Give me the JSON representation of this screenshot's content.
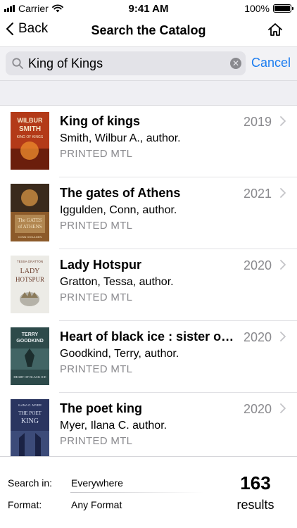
{
  "status_bar": {
    "carrier": "Carrier",
    "time": "9:41 AM",
    "battery_text": "100%",
    "battery_level": 1.0
  },
  "nav": {
    "back_label": "Back",
    "title": "Search the Catalog",
    "home_icon": "home-icon"
  },
  "search": {
    "value": "King of Kings",
    "cancel_label": "Cancel"
  },
  "results": [
    {
      "title": "King of kings",
      "year": "2019",
      "author": "Smith, Wilbur A., author.",
      "format": "PRINTED MTL",
      "cover": {
        "lines": [
          "WILBUR",
          "SMITH",
          "KING OF KINGS"
        ],
        "bg": "#b33a18",
        "fg": "#f5e6c8"
      }
    },
    {
      "title": "The gates of Athens",
      "year": "2021",
      "author": "Iggulden, Conn, author.",
      "format": "PRINTED MTL",
      "cover": {
        "lines": [
          "The GATES",
          "of ATHENS",
          "CONN IGGULDEN"
        ],
        "bg": "#8c5a2a",
        "fg": "#f3e2c0"
      }
    },
    {
      "title": "Lady Hotspur",
      "year": "2020",
      "author": "Gratton, Tessa, author.",
      "format": "PRINTED MTL",
      "cover": {
        "lines": [
          "TESSA GRATTON",
          "LADY",
          "HOTSPUR"
        ],
        "bg": "#ecebe6",
        "fg": "#6b3d2c"
      }
    },
    {
      "title": "Heart of black ice : sister of...",
      "year": "2020",
      "author": "Goodkind, Terry, author.",
      "format": "PRINTED MTL",
      "cover": {
        "lines": [
          "TERRY",
          "GOODKIND",
          "HEART OF BLACK ICE"
        ],
        "bg": "#2d4a4a",
        "fg": "#e8eef0"
      }
    },
    {
      "title": "The poet king",
      "year": "2020",
      "author": "Myer, Ilana C. author.",
      "format": "PRINTED MTL",
      "cover": {
        "lines": [
          "ILANA C. MYER",
          "THE POET",
          "KING"
        ],
        "bg": "#2a3560",
        "fg": "#d9dff0"
      }
    }
  ],
  "footer": {
    "search_in_label": "Search in:",
    "search_in_value": "Everywhere",
    "format_label": "Format:",
    "format_value": "Any Format",
    "count": "163",
    "count_label": "results"
  },
  "colors": {
    "accent": "#1a7cf0",
    "secondary_text": "#8a8a8e",
    "search_bg": "#e3e3e8",
    "band_bg": "#efeff3"
  }
}
